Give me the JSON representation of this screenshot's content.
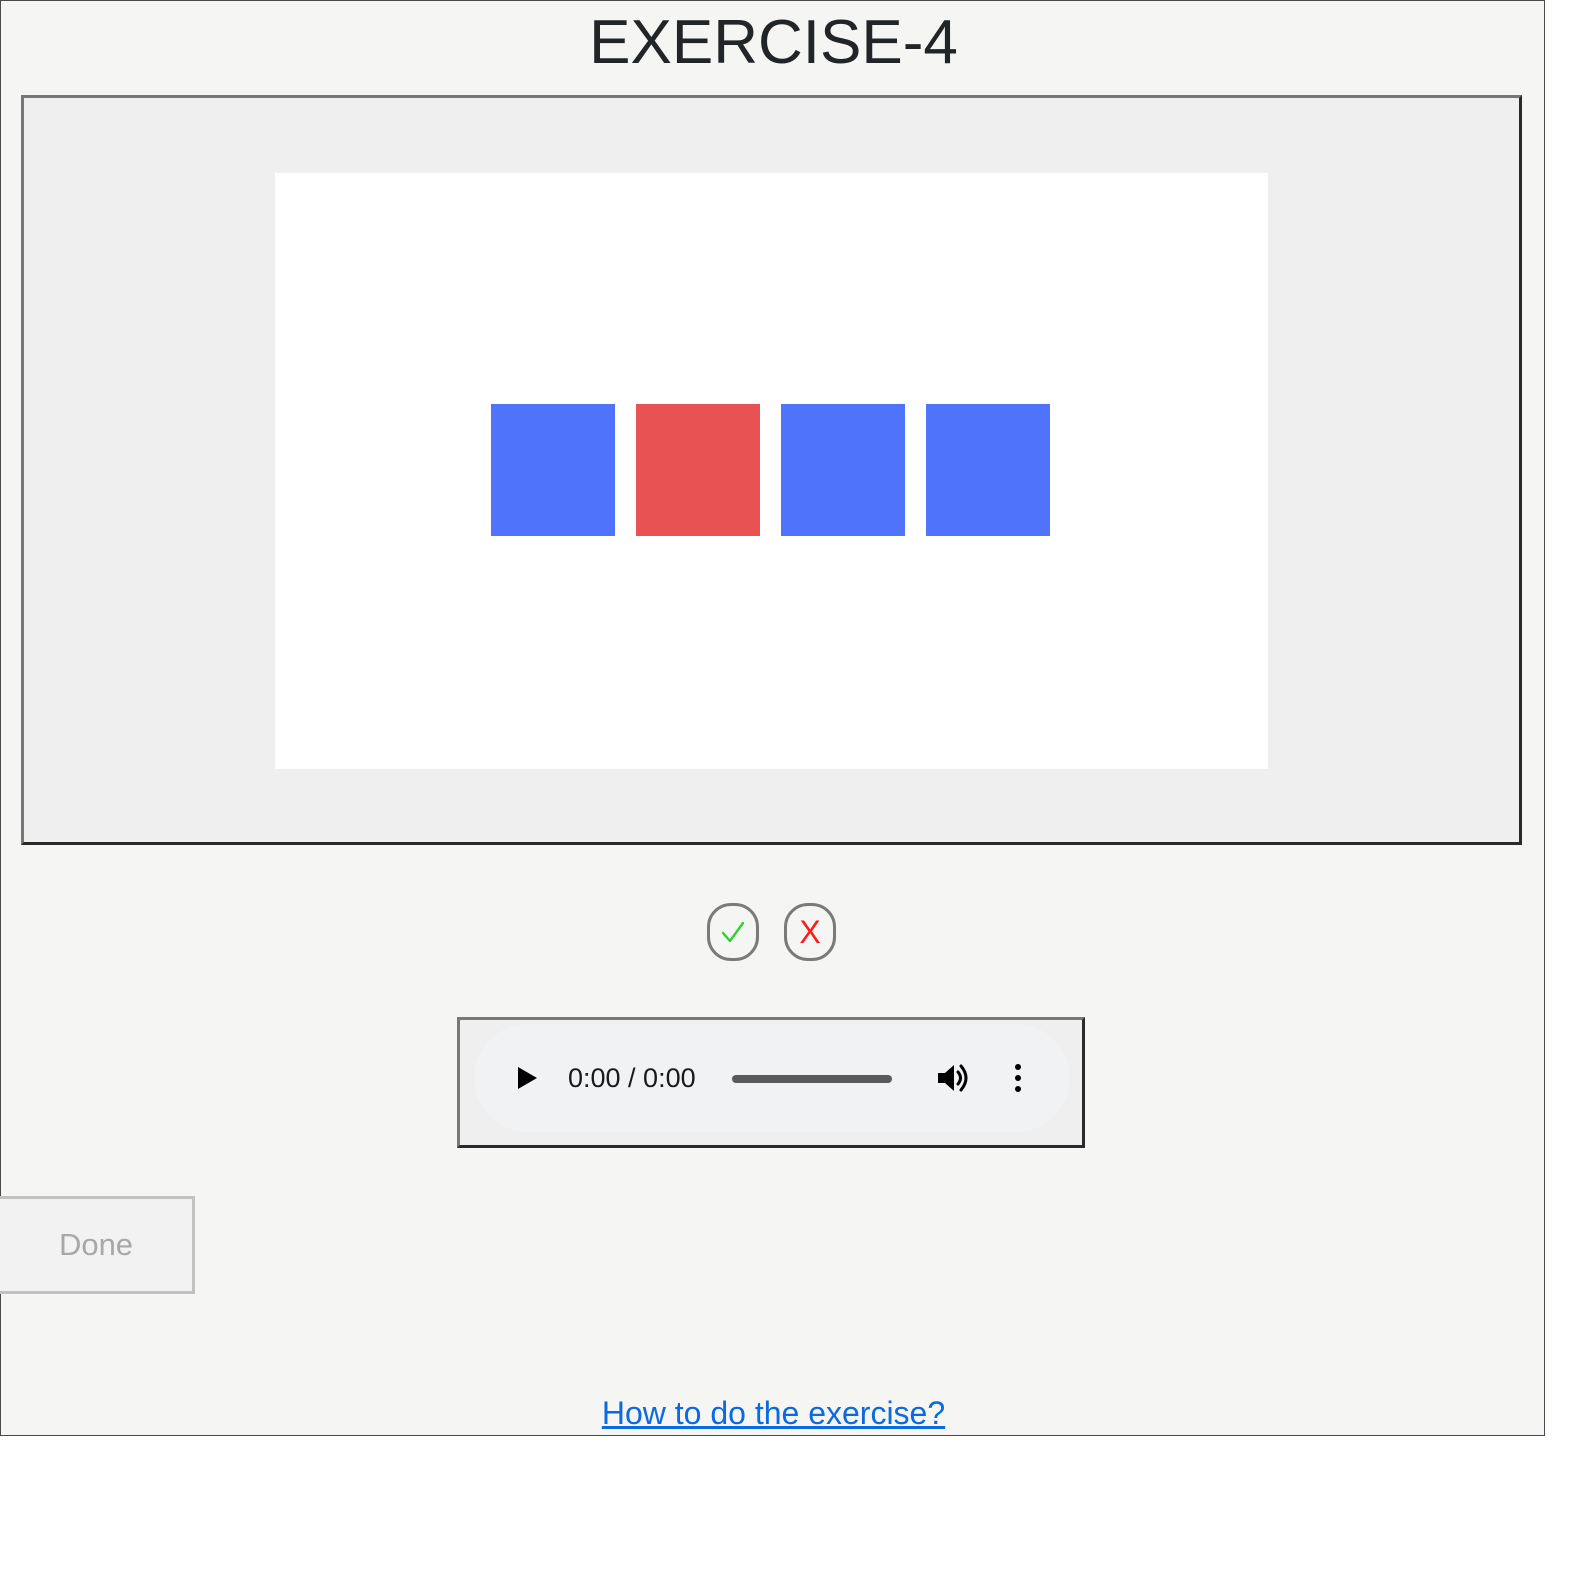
{
  "page": {
    "title": "EXERCISE-4"
  },
  "stage": {
    "squares": [
      {
        "color": "#5073fc"
      },
      {
        "color": "#e85252"
      },
      {
        "color": "#5073fc"
      },
      {
        "color": "#5073fc"
      }
    ]
  },
  "answers": {
    "correct_icon": "check-icon",
    "correct_color": "#2fd12f",
    "wrong_label": "X",
    "wrong_color": "#ff1a1a"
  },
  "audio": {
    "time_display": "0:00 / 0:00",
    "progress": 0
  },
  "actions": {
    "done_label": "Done"
  },
  "help": {
    "link_text": "How to do the exercise?"
  }
}
